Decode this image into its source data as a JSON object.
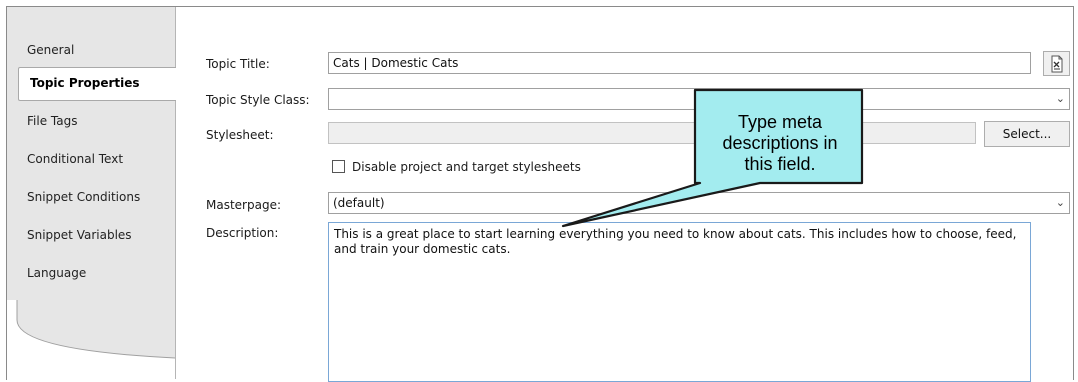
{
  "tabs": [
    {
      "label": "General"
    },
    {
      "label": "Topic Properties"
    },
    {
      "label": "File Tags"
    },
    {
      "label": "Conditional Text"
    },
    {
      "label": "Snippet Conditions"
    },
    {
      "label": "Snippet Variables"
    },
    {
      "label": "Language"
    }
  ],
  "active_tab": "Topic Properties",
  "form": {
    "topic_title_label": "Topic Title:",
    "topic_title_value": "Cats | Domestic Cats",
    "style_class_label": "Topic Style Class:",
    "style_class_value": "",
    "stylesheet_label": "Stylesheet:",
    "stylesheet_value": "",
    "select_button": "Select...",
    "disable_checkbox_label": "Disable project and target stylesheets",
    "disable_checkbox_checked": false,
    "masterpage_label": "Masterpage:",
    "masterpage_value": "(default)",
    "description_label": "Description:",
    "description_value": "This is a great place to start learning everything you need to know about cats. This includes how to choose, feed, and train your domestic cats."
  },
  "callout": {
    "line1": "Type meta",
    "line2": "descriptions in",
    "line3": "this field.",
    "fill": "#a3ecef"
  },
  "icons": {
    "title_button_icon": "document-x-icon",
    "dropdown_icon": "chevron-down-icon"
  }
}
